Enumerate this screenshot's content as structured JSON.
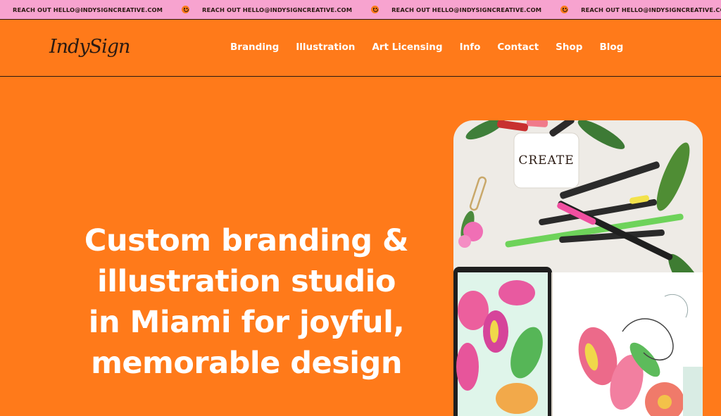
{
  "ticker": {
    "text": "REACH OUT HELLO@INDYSIGNCREATIVE.COM",
    "icon": "smiley-icon"
  },
  "header": {
    "logo": "IndySign",
    "nav": [
      {
        "label": "Branding"
      },
      {
        "label": "Illustration"
      },
      {
        "label": "Art Licensing"
      },
      {
        "label": "Info"
      },
      {
        "label": "Contact"
      },
      {
        "label": "Shop"
      },
      {
        "label": "Blog"
      }
    ]
  },
  "hero": {
    "headline_lines": [
      "Custom branding &",
      "illustration studio",
      "in Miami for joyful,",
      "memorable design"
    ],
    "photo": {
      "mug_label": "CREATE"
    }
  },
  "colors": {
    "background": "#ff7a1a",
    "ticker_bg": "#f7a3cf",
    "text_dark": "#2a1a12",
    "text_light": "#ffffff"
  }
}
